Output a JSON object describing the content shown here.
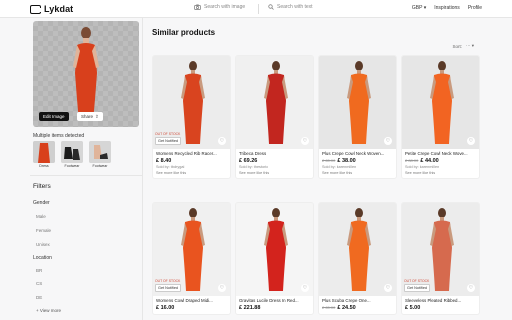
{
  "brand": "Lykdat",
  "header": {
    "search_image_label": "Search with image",
    "search_text_placeholder": "Search with text",
    "currency": "GBP",
    "nav_inspirations": "Inspirations",
    "nav_profile": "Profile"
  },
  "sidebar": {
    "edit_image_label": "Edit Image",
    "share_label": "Share",
    "multiple_items_label": "Multiple items detected",
    "thumbs": [
      {
        "label": "Dress"
      },
      {
        "label": "Footwear"
      },
      {
        "label": "Footwear"
      }
    ],
    "filters_heading": "Filters",
    "gender_label": "Gender",
    "gender_options": [
      "Male",
      "Female",
      "Unisex"
    ],
    "location_label": "Location",
    "location_options": [
      "BR",
      "CS",
      "DE"
    ],
    "view_more_label": "+ View more"
  },
  "main": {
    "title": "Similar products",
    "sort_label": "Sort:",
    "products": [
      {
        "title": "Womens Recycled Rib Racer...",
        "price": "£ 8.40",
        "old_price": "",
        "seller": "Sold by: tbdrygal",
        "link": "See more like this",
        "out_of_stock": "OUT OF STOCK",
        "notify": "Get Notified",
        "dress_color": "#d9441f",
        "bg": "#ececec"
      },
      {
        "title": "Tribeca Dress",
        "price": "£ 69.26",
        "old_price": "",
        "seller": "Sold by: thestoric",
        "link": "See more like this",
        "out_of_stock": "",
        "notify": "",
        "dress_color": "#c2261f",
        "bg": "#f0f0f0"
      },
      {
        "title": "Plus Crepe Cowl Neck Woven...",
        "price": "£ 38.00",
        "old_price": "£ 65.00",
        "seller": "Sold by: karenmillen",
        "link": "See more like this",
        "out_of_stock": "",
        "notify": "",
        "dress_color": "#f06a1f",
        "bg": "#e6e6e6"
      },
      {
        "title": "Petite Crepe Cowl Neck Wove...",
        "price": "£ 44.00",
        "old_price": "£ 88.00",
        "seller": "Sold by: karenmillen",
        "link": "See more like this",
        "out_of_stock": "",
        "notify": "",
        "dress_color": "#f26422",
        "bg": "#e6e6e6"
      },
      {
        "title": "Womens Cowl Draped Midi...",
        "price": "£ 16.00",
        "old_price": "",
        "seller": "",
        "link": "",
        "out_of_stock": "OUT OF STOCK",
        "notify": "Get Notified",
        "dress_color": "#e9541f",
        "bg": "#f0f0f0"
      },
      {
        "title": "Gravitas Lucile Dress In Red...",
        "price": "£ 221.88",
        "old_price": "",
        "seller": "",
        "link": "",
        "out_of_stock": "",
        "notify": "",
        "dress_color": "#d3231d",
        "bg": "#f5f5f5"
      },
      {
        "title": "Plus Scuba Crepe One...",
        "price": "£ 24.50",
        "old_price": "£ 65.00",
        "seller": "",
        "link": "",
        "out_of_stock": "",
        "notify": "",
        "dress_color": "#f06a20",
        "bg": "#ececec"
      },
      {
        "title": "Sleeveless Pleated Ribbed...",
        "price": "£ 5.00",
        "old_price": "",
        "seller": "",
        "link": "",
        "out_of_stock": "OUT OF STOCK",
        "notify": "Get Notified",
        "dress_color": "#d66a4e",
        "bg": "#ececec"
      }
    ]
  },
  "colors": {
    "accent": "#111111",
    "dress_query": "#d8401c"
  }
}
